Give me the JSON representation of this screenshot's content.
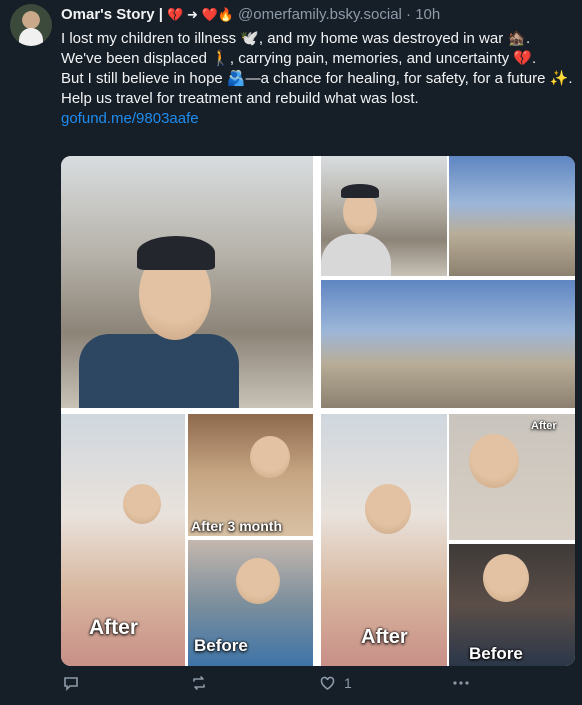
{
  "post": {
    "author_name": "Omar's Story |",
    "author_emojis": "💔 ➜ ❤️🔥",
    "handle": "@omerfamily.bsky.social",
    "time": "· 10h",
    "lines": [
      "I lost my children to illness 🕊️, and my home was destroyed in war 🏚️.",
      "We've been displaced 🚶, carrying pain, memories, and uncertainty 💔.",
      "But I still believe in hope 🫂—a chance for healing, for safety, for a future ✨.",
      "Help us travel for treatment and rebuild what was lost."
    ],
    "link": "gofund.me/9803aafe"
  },
  "media": {
    "labels": {
      "after_3_month": "After 3 month",
      "after_left": "After",
      "before_left": "Before",
      "after_right_small": "After",
      "after_right": "After",
      "before_right": "Before"
    }
  },
  "actions": {
    "reply_count": "",
    "repost_count": "",
    "like_count": "1"
  },
  "colors": {
    "background": "#161e27",
    "link": "#1d8cf0",
    "muted": "#8d9aa8",
    "heart": "#e0245e"
  }
}
